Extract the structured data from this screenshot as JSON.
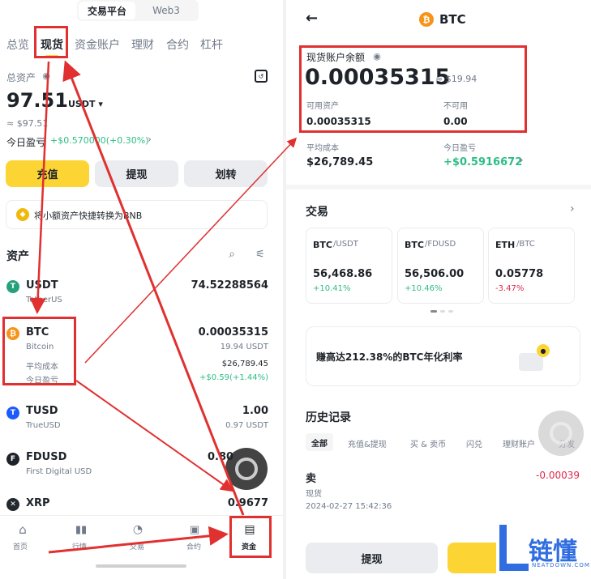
{
  "left": {
    "platform_tabs": [
      "交易平台",
      "Web3"
    ],
    "nav_tabs": [
      "总览",
      "现货",
      "资金账户",
      "理财",
      "合约",
      "杠杆"
    ],
    "total_assets_label": "总资产",
    "total_value": "97.51",
    "currency": "USDT",
    "approx_value": "≈ $97.51",
    "today_pnl_label": "今日盈亏",
    "today_pnl_value": "+$0.570000(+0.30%)",
    "buttons": {
      "deposit": "充值",
      "withdraw": "提现",
      "transfer": "划转"
    },
    "bnb_banner": "将小额资产快捷转换为BNB",
    "assets_title": "资产",
    "assets": [
      {
        "symbol": "USDT",
        "name": "TetherUS",
        "amount": "74.52288564",
        "usd": "",
        "icon_color": "#26a17b",
        "icon_char": "T"
      },
      {
        "symbol": "BTC",
        "name": "Bitcoin",
        "amount": "0.00035315",
        "usd": "19.94 USDT",
        "icon_color": "#f7931a",
        "icon_char": "₿",
        "avg_cost_label": "平均成本",
        "avg_cost": "$26,789.45",
        "pnl_label": "今日盈亏",
        "pnl": "+$0.59(+1.44%)"
      },
      {
        "symbol": "TUSD",
        "name": "TrueUSD",
        "amount": "1.00",
        "usd": "0.97 USDT",
        "icon_color": "#1a5aff",
        "icon_char": "T"
      },
      {
        "symbol": "FDUSD",
        "name": "First Digital USD",
        "amount": "0.80",
        "usd": "",
        "icon_color": "#1e2329",
        "icon_char": "F"
      },
      {
        "symbol": "XRP",
        "name": "",
        "amount": "0.9677",
        "usd": "",
        "icon_color": "#23292f",
        "icon_char": "✕"
      }
    ],
    "bottom_nav": [
      "首页",
      "行情",
      "交易",
      "合约",
      "资金"
    ]
  },
  "right": {
    "title": "BTC",
    "balance_label": "现货账户余额",
    "balance": "0.00035315",
    "balance_usd": "≈ $19.94",
    "available_label": "可用资产",
    "available": "0.00035315",
    "unavailable_label": "不可用",
    "unavailable": "0.00",
    "avg_cost_label": "平均成本",
    "avg_cost": "$26,789.45",
    "today_pnl_label": "今日盈亏",
    "today_pnl": "+$0.5916672",
    "trade_title": "交易",
    "pairs": [
      {
        "base": "BTC",
        "quote": "/USDT",
        "price": "56,468.86",
        "change": "+10.41%",
        "up": true
      },
      {
        "base": "BTC",
        "quote": "/FDUSD",
        "price": "56,506.00",
        "change": "+10.46%",
        "up": true
      },
      {
        "base": "ETH",
        "quote": "/BTC",
        "price": "0.05778",
        "change": "-3.47%",
        "up": false
      }
    ],
    "earn_banner": "赚高达212.38%的BTC年化利率",
    "history_title": "历史记录",
    "history_tabs": [
      "全部",
      "充值&提现",
      "买 & 卖币",
      "闪兑",
      "理财账户",
      "分发"
    ],
    "history_item": {
      "type": "卖",
      "sub": "现货",
      "time": "2024-02-27 15:42:36",
      "amount": "-0.00039"
    },
    "withdraw_button": "提现"
  },
  "watermark": {
    "brand": "链懂",
    "site": "NEATDOWN.COM"
  },
  "colors": {
    "accent": "#fcd535",
    "highlight": "#e03030",
    "green": "#2ebd85",
    "red": "#e0294a"
  }
}
